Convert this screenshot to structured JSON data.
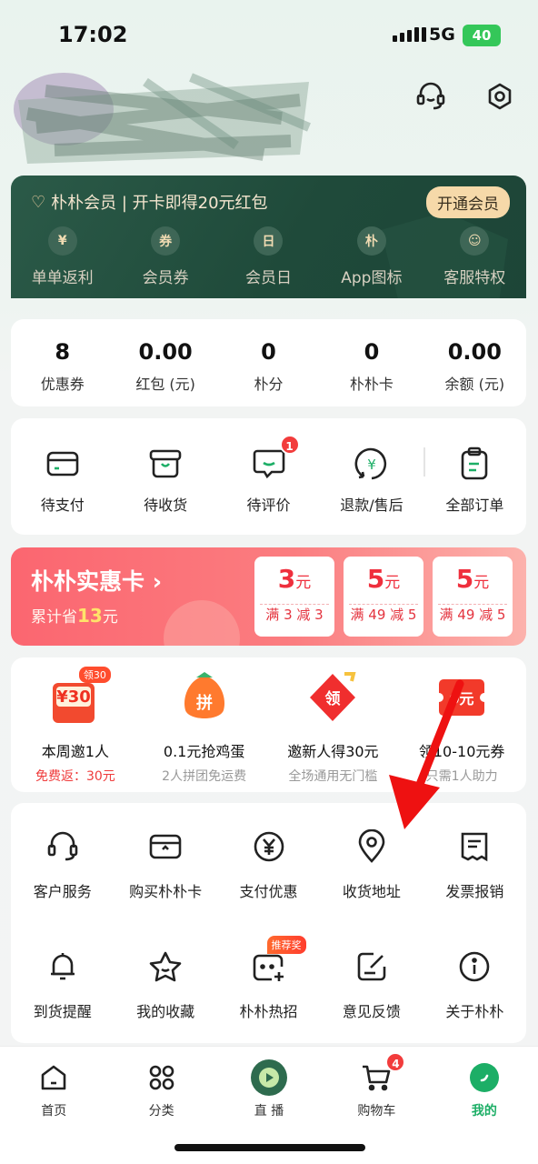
{
  "status": {
    "time": "17:02",
    "network": "5G",
    "battery": "40"
  },
  "vip": {
    "title": "朴朴会员 | 开卡即得20元红包",
    "open_button": "开通会员",
    "items": [
      {
        "icon": "¥",
        "label": "单单返利"
      },
      {
        "icon": "券",
        "label": "会员券"
      },
      {
        "icon": "日",
        "label": "会员日"
      },
      {
        "icon": "朴",
        "label": "App图标"
      },
      {
        "icon": "☺",
        "label": "客服特权"
      }
    ]
  },
  "assets": [
    {
      "value": "8",
      "label": "优惠券"
    },
    {
      "value": "0.00",
      "label": "红包 (元)"
    },
    {
      "value": "0",
      "label": "朴分"
    },
    {
      "value": "0",
      "label": "朴朴卡"
    },
    {
      "value": "0.00",
      "label": "余额 (元)"
    }
  ],
  "orders": [
    {
      "icon": "wallet-icon",
      "label": "待支付"
    },
    {
      "icon": "box-icon",
      "label": "待收货"
    },
    {
      "icon": "comment-icon",
      "label": "待评价",
      "badge": "1"
    },
    {
      "icon": "refund-icon",
      "label": "退款/售后"
    },
    {
      "icon": "clipboard-icon",
      "label": "全部订单"
    }
  ],
  "saver": {
    "title": "朴朴实惠卡 ›",
    "sub_prefix": "累计省",
    "sub_amount": "13",
    "sub_suffix": "元",
    "coupons": [
      {
        "amount": "3",
        "unit": "元",
        "condition": "满 3 减 3"
      },
      {
        "amount": "5",
        "unit": "元",
        "condition": "满 49 减 5"
      },
      {
        "amount": "5",
        "unit": "元",
        "condition": "满 49 减 5"
      }
    ]
  },
  "promos": [
    {
      "title": "本周邀1人",
      "sub": "免费返：30元",
      "icon_text": "¥30",
      "tag": "领30"
    },
    {
      "title": "0.1元抢鸡蛋",
      "sub": "2人拼团免运费",
      "icon_text": "拼"
    },
    {
      "title": "邀新人得30元",
      "sub": "全场通用无门槛",
      "icon_text": "领"
    },
    {
      "title": "领10-10元券",
      "sub": "只需1人助力",
      "icon_text": "0元"
    }
  ],
  "services": [
    {
      "icon": "headset-icon",
      "label": "客户服务"
    },
    {
      "icon": "card-icon",
      "label": "购买朴朴卡"
    },
    {
      "icon": "yen-icon",
      "label": "支付优惠"
    },
    {
      "icon": "location-icon",
      "label": "收货地址"
    },
    {
      "icon": "invoice-icon",
      "label": "发票报销"
    },
    {
      "icon": "bell-icon",
      "label": "到货提醒"
    },
    {
      "icon": "star-icon",
      "label": "我的收藏"
    },
    {
      "icon": "hot-icon",
      "label": "朴朴热招",
      "tag": "推荐奖"
    },
    {
      "icon": "feedback-icon",
      "label": "意见反馈"
    },
    {
      "icon": "info-icon",
      "label": "关于朴朴"
    }
  ],
  "tabs": [
    {
      "icon": "home-icon",
      "label": "首页"
    },
    {
      "icon": "category-icon",
      "label": "分类"
    },
    {
      "icon": "live-icon",
      "label": "直 播"
    },
    {
      "icon": "cart-icon",
      "label": "购物车",
      "badge": "4"
    },
    {
      "icon": "me-icon",
      "label": "我的",
      "active": true
    }
  ],
  "colors": {
    "brand_green": "#1cae66",
    "vip_green": "#1f4a3a",
    "saver_red": "#fb6670",
    "annotation_red": "#ee1111"
  }
}
